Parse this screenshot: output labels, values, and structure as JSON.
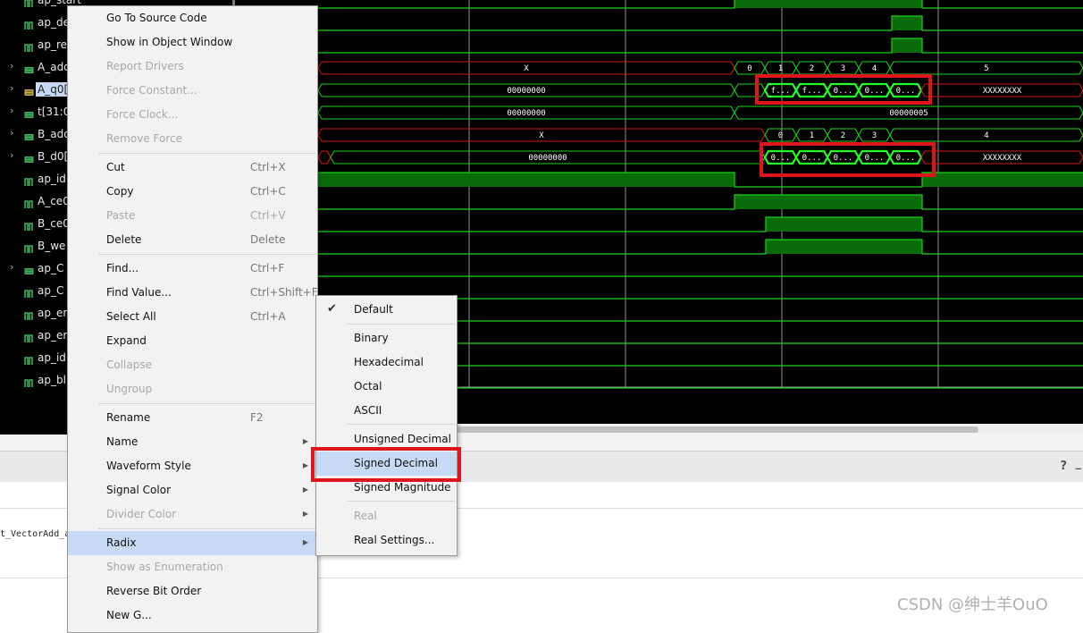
{
  "signals": [
    {
      "name": "ap_start",
      "icon": "bit",
      "expandable": false
    },
    {
      "name": "ap_de",
      "icon": "bit",
      "expandable": false
    },
    {
      "name": "ap_re",
      "icon": "bit",
      "expandable": false
    },
    {
      "name": "A_add",
      "icon": "bus",
      "expandable": true
    },
    {
      "name": "A_q0[",
      "icon": "bus-orange",
      "expandable": true,
      "selected": true
    },
    {
      "name": "t[31:0]",
      "icon": "bus",
      "expandable": true
    },
    {
      "name": "B_add",
      "icon": "bus",
      "expandable": true
    },
    {
      "name": "B_d0[",
      "icon": "bus",
      "expandable": true
    },
    {
      "name": "ap_id",
      "icon": "bit",
      "expandable": false
    },
    {
      "name": "A_ce0",
      "icon": "bit",
      "expandable": false
    },
    {
      "name": "B_ce0",
      "icon": "bit",
      "expandable": false
    },
    {
      "name": "B_we",
      "icon": "bit",
      "expandable": false
    },
    {
      "name": "ap_C",
      "icon": "bus",
      "expandable": true
    },
    {
      "name": "ap_C",
      "icon": "bit",
      "expandable": false
    },
    {
      "name": "ap_er",
      "icon": "bit",
      "expandable": false
    },
    {
      "name": "ap_er",
      "icon": "bit",
      "expandable": false
    },
    {
      "name": "ap_id",
      "icon": "bit",
      "expandable": false
    },
    {
      "name": "ap_bl",
      "icon": "bit",
      "expandable": false
    }
  ],
  "first_value_cell": "0",
  "waves": {
    "A_addr": {
      "labels": [
        "X",
        "0",
        "1",
        "2",
        "3",
        "4",
        "5"
      ]
    },
    "A_q0": {
      "labels": [
        "00000000",
        "f...",
        "f...",
        "0...",
        "0...",
        "0...",
        "XXXXXXXX"
      ]
    },
    "t": {
      "labels": [
        "00000000",
        "00000005"
      ]
    },
    "B_addr": {
      "labels": [
        "X",
        "0",
        "1",
        "2",
        "3",
        "4"
      ]
    },
    "B_d0": {
      "labels": [
        "00000000",
        "0...",
        "0...",
        "0...",
        "0...",
        "0...",
        "XXXXXXXX"
      ]
    }
  },
  "context_menu": [
    {
      "label": "Go To Source Code",
      "enabled": true
    },
    {
      "label": "Show in Object Window",
      "enabled": true
    },
    {
      "label": "Report Drivers",
      "enabled": false
    },
    {
      "label": "Force Constant...",
      "enabled": false
    },
    {
      "label": "Force Clock...",
      "enabled": false
    },
    {
      "label": "Remove Force",
      "enabled": false
    },
    {
      "label": "Cut",
      "shortcut": "Ctrl+X",
      "enabled": true
    },
    {
      "label": "Copy",
      "shortcut": "Ctrl+C",
      "enabled": true
    },
    {
      "label": "Paste",
      "shortcut": "Ctrl+V",
      "enabled": false
    },
    {
      "label": "Delete",
      "shortcut": "Delete",
      "enabled": true
    },
    {
      "label": "Find...",
      "shortcut": "Ctrl+F",
      "enabled": true
    },
    {
      "label": "Find Value...",
      "shortcut": "Ctrl+Shift+F",
      "enabled": true
    },
    {
      "label": "Select All",
      "shortcut": "Ctrl+A",
      "enabled": true
    },
    {
      "label": "Expand",
      "enabled": true
    },
    {
      "label": "Collapse",
      "enabled": false
    },
    {
      "label": "Ungroup",
      "enabled": false
    },
    {
      "label": "Rename",
      "shortcut": "F2",
      "enabled": true
    },
    {
      "label": "Name",
      "submenu": true,
      "enabled": true
    },
    {
      "label": "Waveform Style",
      "submenu": true,
      "enabled": true
    },
    {
      "label": "Signal Color",
      "submenu": true,
      "enabled": true
    },
    {
      "label": "Divider Color",
      "submenu": true,
      "enabled": false
    },
    {
      "label": "Radix",
      "submenu": true,
      "enabled": true,
      "highlighted": true
    },
    {
      "label": "Show as Enumeration",
      "enabled": false
    },
    {
      "label": "Reverse Bit Order",
      "enabled": true
    },
    {
      "label": "New G...",
      "enabled": true
    }
  ],
  "radix_menu": [
    {
      "label": "Default",
      "checked": true,
      "enabled": true
    },
    {
      "label": "Binary",
      "enabled": true
    },
    {
      "label": "Hexadecimal",
      "enabled": true
    },
    {
      "label": "Octal",
      "enabled": true
    },
    {
      "label": "ASCII",
      "enabled": true
    },
    {
      "label": "Unsigned Decimal",
      "enabled": true
    },
    {
      "label": "Signed Decimal",
      "enabled": true,
      "highlighted": true
    },
    {
      "label": "Signed Magnitude",
      "enabled": true
    },
    {
      "label": "Real",
      "enabled": false
    },
    {
      "label": "Real Settings...",
      "enabled": true
    }
  ],
  "bottom_panel": {
    "help_label": "?",
    "minimize_label": "_",
    "console_text": "t_VectorAdd_a"
  },
  "watermark": "CSDN @绅士羊OuO",
  "colors": {
    "wave_green": "#19d319",
    "wave_fill": "#0a6b0a",
    "undefined_red": "#d41818",
    "highlight_box": "#e0151b",
    "menu_highlight": "#c7daf5"
  }
}
